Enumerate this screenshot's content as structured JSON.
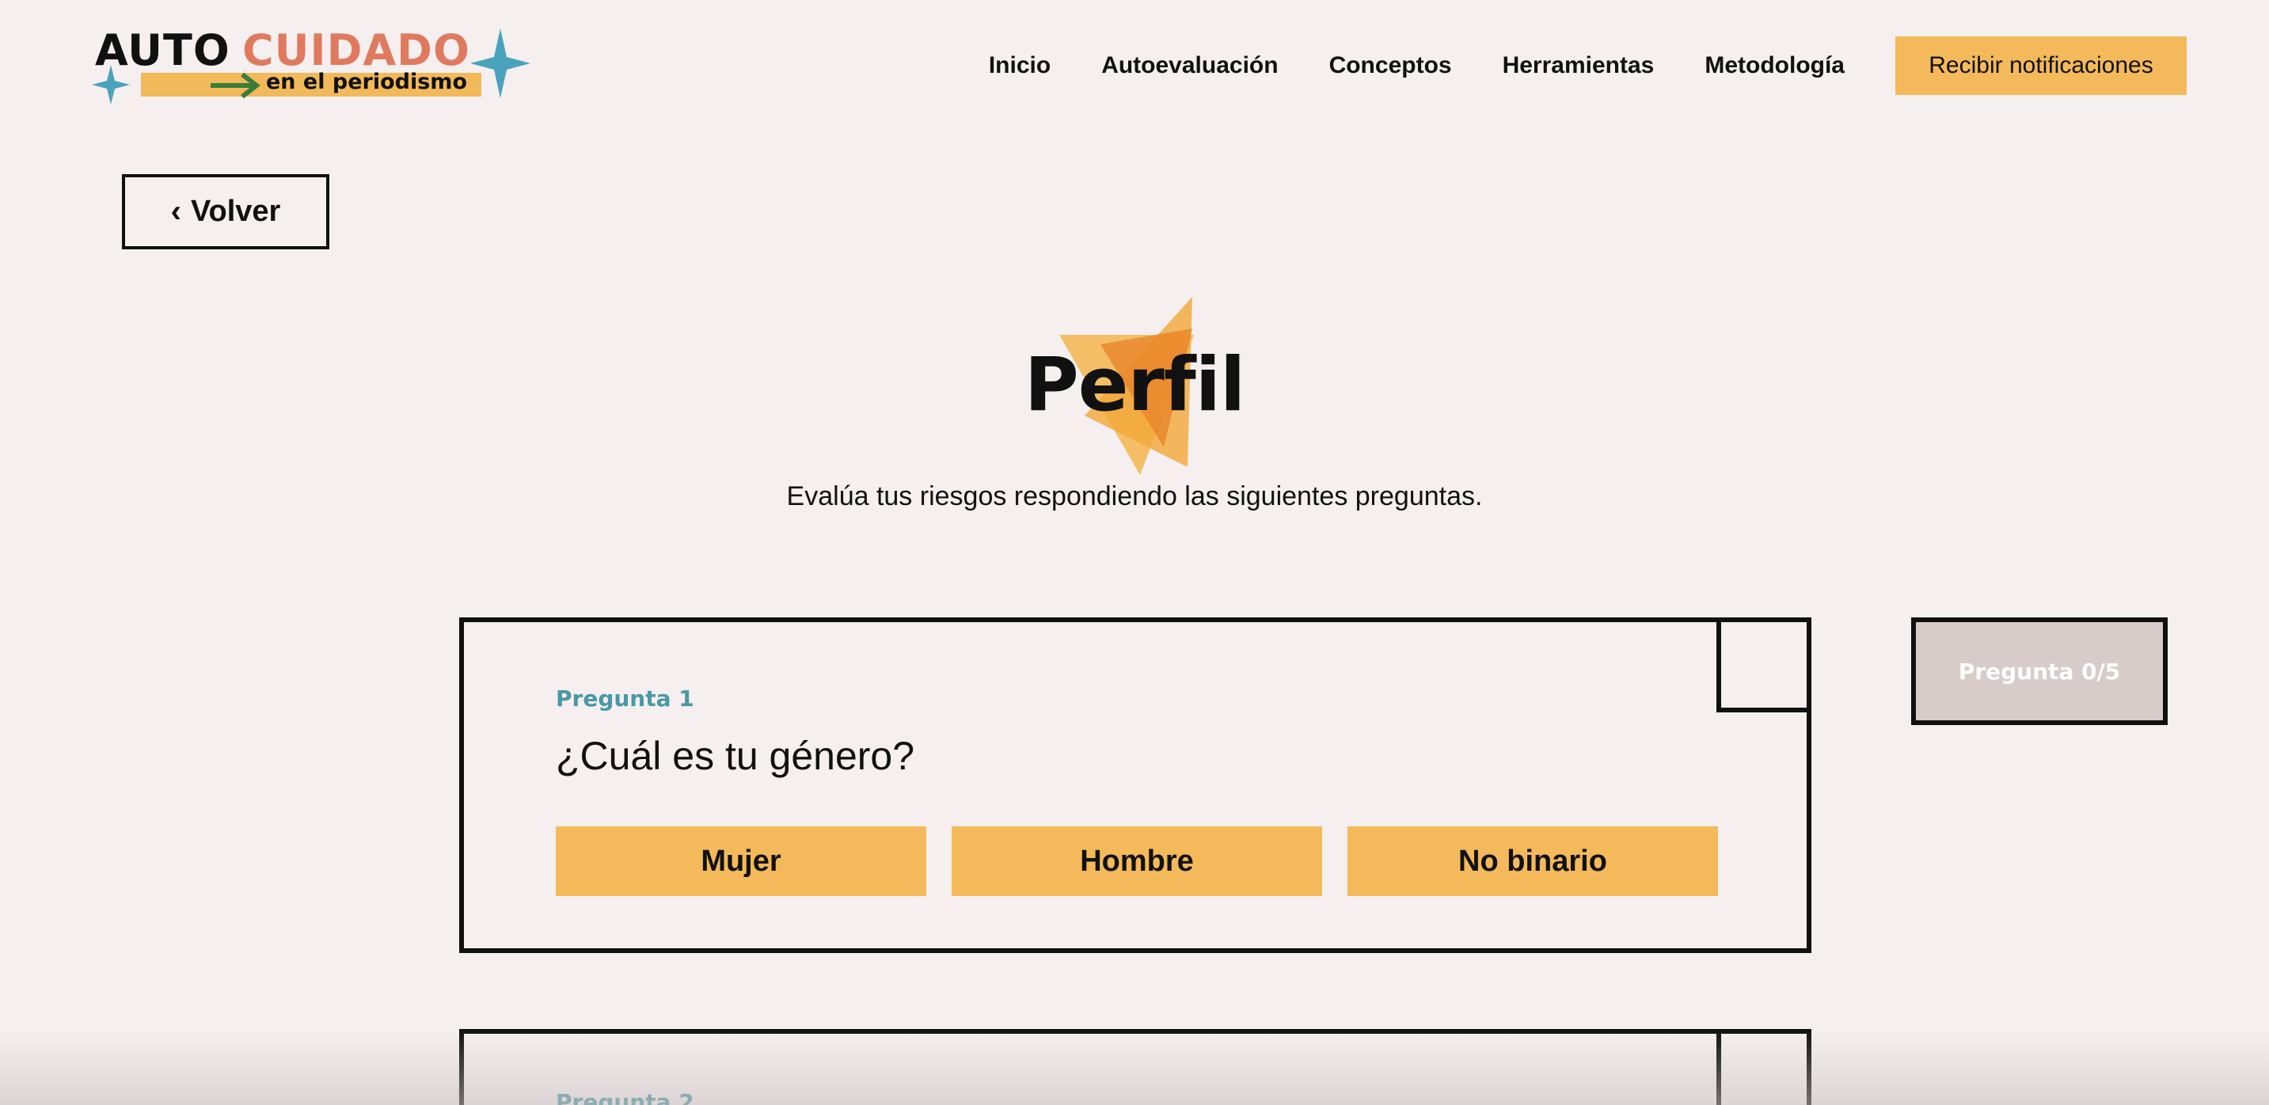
{
  "header": {
    "logo": {
      "word1": "AUTO",
      "word2": "CUIDADO",
      "subtitle": "en el periodismo"
    },
    "nav": [
      "Inicio",
      "Autoevaluación",
      "Conceptos",
      "Herramientas",
      "Metodología"
    ],
    "cta_label": "Recibir notificaciones"
  },
  "back_label": "Volver",
  "hero": {
    "title": "Perfil",
    "subtitle": "Evalúa tus riesgos respondiendo las siguientes preguntas."
  },
  "questions": [
    {
      "label": "Pregunta 1",
      "text": "¿Cuál es tu género?",
      "options": [
        "Mujer",
        "Hombre",
        "No binario"
      ]
    },
    {
      "label": "Pregunta 2"
    }
  ],
  "progress": {
    "label": "Pregunta 0/5",
    "answered": 0,
    "total": 5
  },
  "colors": {
    "accent": "#f4b95a",
    "brand_orange": "#e07a5f",
    "teal": "#4a98a6",
    "background": "#f5efef"
  }
}
